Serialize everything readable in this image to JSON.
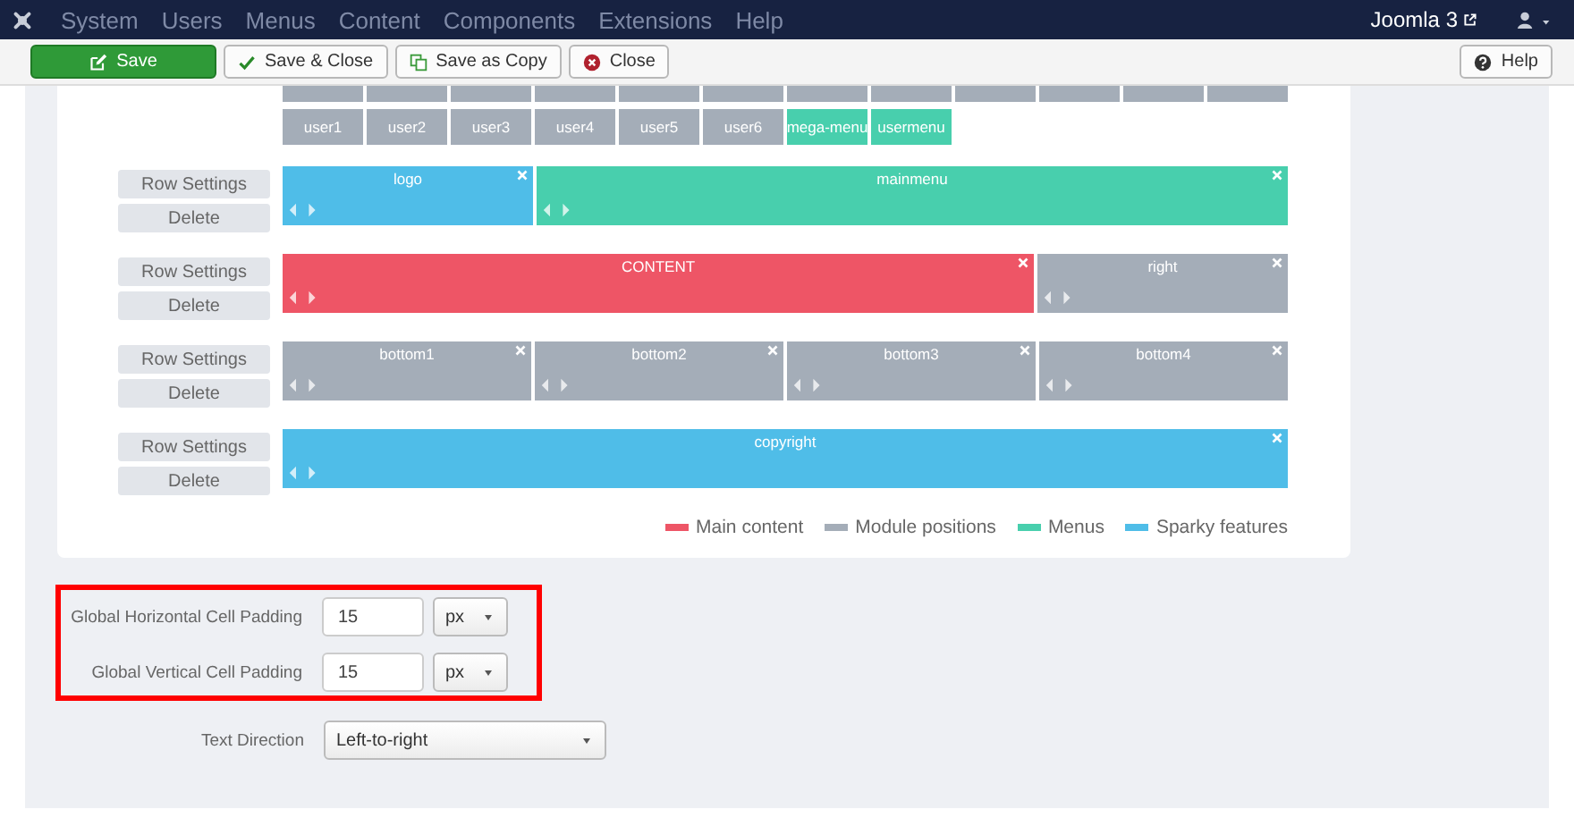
{
  "navbar": {
    "menus": [
      "System",
      "Users",
      "Menus",
      "Content",
      "Components",
      "Extensions",
      "Help"
    ],
    "site_link": "Joomla 3"
  },
  "toolbar": {
    "buttons": [
      {
        "label": "Save",
        "kind": "save"
      },
      {
        "label": "Save & Close",
        "kind": "save-close"
      },
      {
        "label": "Save as Copy",
        "kind": "copy"
      },
      {
        "label": "Close",
        "kind": "close"
      }
    ],
    "help": "Help"
  },
  "palette": {
    "cut_row": [
      {
        "kind": "module"
      },
      {
        "kind": "module"
      },
      {
        "kind": "module"
      },
      {
        "kind": "module"
      },
      {
        "kind": "module"
      },
      {
        "kind": "module"
      },
      {
        "kind": "module"
      },
      {
        "kind": "module"
      },
      {
        "kind": "module"
      },
      {
        "kind": "module"
      },
      {
        "kind": "module"
      },
      {
        "kind": "module"
      }
    ],
    "tiles": [
      {
        "label": "user1",
        "kind": "module"
      },
      {
        "label": "user2",
        "kind": "module"
      },
      {
        "label": "user3",
        "kind": "module"
      },
      {
        "label": "user4",
        "kind": "module"
      },
      {
        "label": "user5",
        "kind": "module"
      },
      {
        "label": "user6",
        "kind": "module"
      },
      {
        "label": "mega-menu",
        "kind": "menu"
      },
      {
        "label": "usermenu",
        "kind": "menu"
      }
    ]
  },
  "rows": [
    {
      "settings": "Row Settings",
      "delete": "Delete",
      "kind": "split",
      "blocks": [
        {
          "label": "logo",
          "kind": "feature"
        },
        {
          "label": "mainmenu",
          "kind": "menu"
        }
      ]
    },
    {
      "settings": "Row Settings",
      "delete": "Delete",
      "kind": "split",
      "blocks": [
        {
          "label": "CONTENT",
          "kind": "content"
        },
        {
          "label": "right",
          "kind": "module"
        }
      ]
    },
    {
      "settings": "Row Settings",
      "delete": "Delete",
      "kind": "quarters",
      "blocks": [
        {
          "label": "bottom1",
          "kind": "module"
        },
        {
          "label": "bottom2",
          "kind": "module"
        },
        {
          "label": "bottom3",
          "kind": "module"
        },
        {
          "label": "bottom4",
          "kind": "module"
        }
      ]
    },
    {
      "settings": "Row Settings",
      "delete": "Delete",
      "kind": "single",
      "blocks": [
        {
          "label": "copyright",
          "kind": "feature"
        }
      ]
    }
  ],
  "legend": [
    {
      "label": "Main content",
      "color": "#ee5566"
    },
    {
      "label": "Module positions",
      "color": "#a4adb8"
    },
    {
      "label": "Menus",
      "color": "#48cfad"
    },
    {
      "label": "Sparky features",
      "color": "#4fbde8"
    }
  ],
  "settings": {
    "padding_fields": [
      {
        "label": "Global Horizontal Cell Padding",
        "value": "15",
        "unit": "px"
      },
      {
        "label": "Global Vertical Cell Padding",
        "value": "15",
        "unit": "px"
      }
    ],
    "text_direction": {
      "label": "Text Direction",
      "value": "Left-to-right"
    }
  }
}
